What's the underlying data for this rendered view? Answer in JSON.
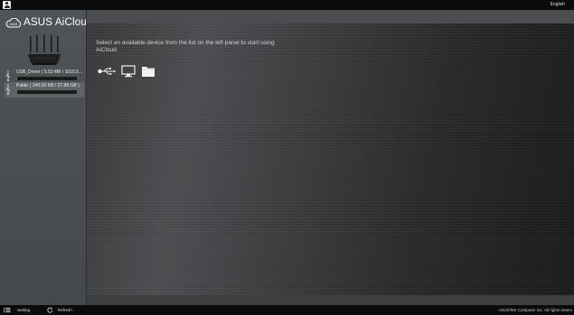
{
  "topbar": {
    "language": "English"
  },
  "sidebar": {
    "app_title": "ASUS AiCloud",
    "devices": [
      {
        "label": "USB_Driver ( 5.53 MB / 1015.5...",
        "usage_fraction": 0.01
      },
      {
        "label": "Public ( 240.00 KB / 27.88 GB )",
        "usage_fraction": 0.01
      }
    ]
  },
  "main": {
    "intro_text": "Select an available device from the list on the left panel to start using AiCloud.",
    "icons": [
      "usb-icon",
      "computer-icon",
      "folder-icon"
    ]
  },
  "footer": {
    "setting_label": "Setting",
    "refresh_label": "Refresh",
    "copyright": "ASUSTeK Computer Inc. All rights reserv"
  },
  "colors": {
    "topbar_bg": "#0b0b0b",
    "sidebar_bg": "#4f5457",
    "selected_row": "#5e6366",
    "progress_track": "#1b1b1b"
  }
}
